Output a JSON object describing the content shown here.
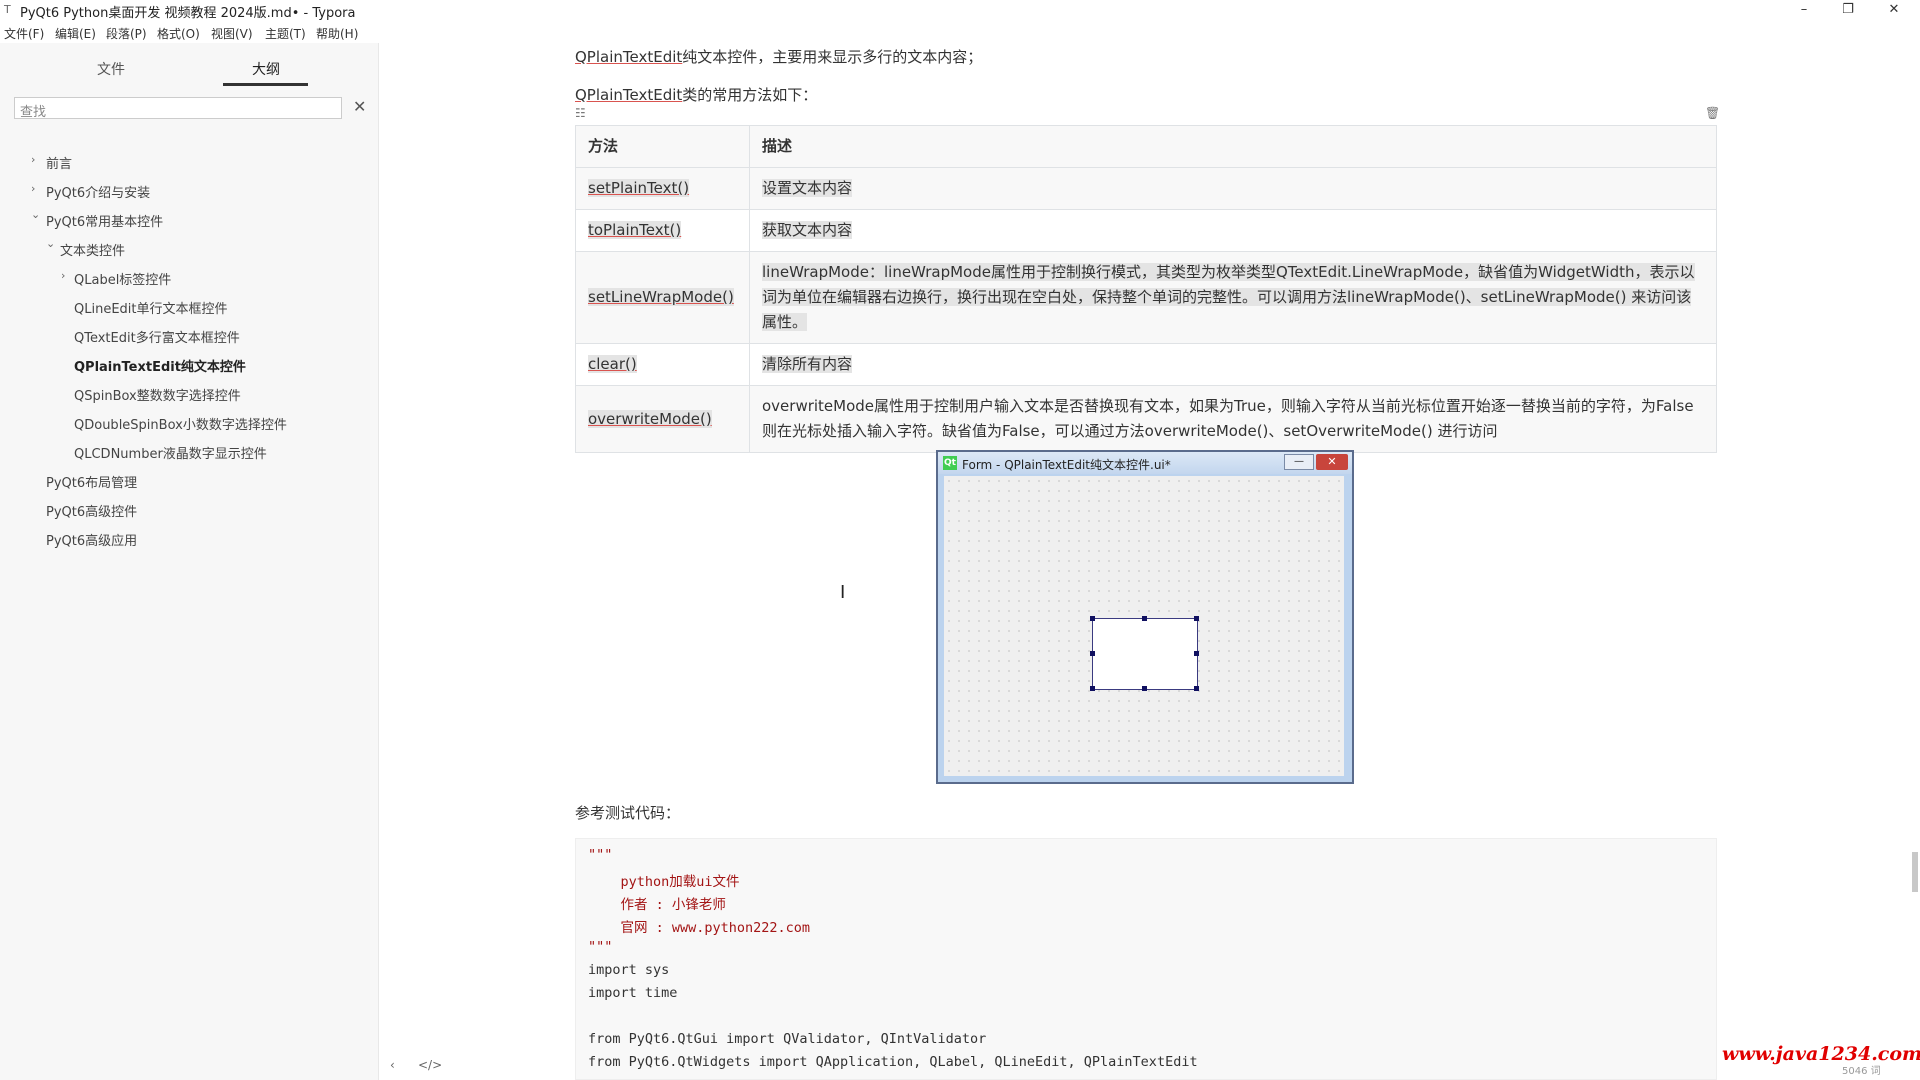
{
  "window": {
    "title": "PyQt6 Python桌面开发 视频教程 2024版.md• - Typora",
    "minimize": "–",
    "restore": "❐",
    "close": "✕"
  },
  "menu": [
    "文件(F)",
    "编辑(E)",
    "段落(P)",
    "格式(O)",
    "视图(V)",
    "主题(T)",
    "帮助(H)"
  ],
  "sidebar": {
    "tab_files": "文件",
    "tab_outline": "大纲",
    "search_placeholder": "查找",
    "search_close": "✕",
    "items": [
      {
        "label": "前言",
        "chev": "›"
      },
      {
        "label": "PyQt6介绍与安装",
        "chev": "›"
      },
      {
        "label": "PyQt6常用基本控件",
        "chev": "⌄"
      },
      {
        "label": "文本类控件",
        "chev": "⌄"
      },
      {
        "label": "QLabel标签控件",
        "chev": "›"
      },
      {
        "label": "QLineEdit单行文本框控件",
        "chev": ""
      },
      {
        "label": "QTextEdit多行富文本框控件",
        "chev": ""
      },
      {
        "label": "QPlainTextEdit纯文本控件",
        "chev": ""
      },
      {
        "label": "QSpinBox整数数字选择控件",
        "chev": ""
      },
      {
        "label": "QDoubleSpinBox小数数字选择控件",
        "chev": ""
      },
      {
        "label": "QLCDNumber液晶数字显示控件",
        "chev": ""
      },
      {
        "label": "PyQt6布局管理",
        "chev": ""
      },
      {
        "label": "PyQt6高级控件",
        "chev": ""
      },
      {
        "label": "PyQt6高级应用",
        "chev": ""
      }
    ],
    "footer_prev": "‹",
    "footer_source": "</>"
  },
  "content": {
    "intro_name": "QPlainTextEdit",
    "intro_rest": "纯文本控件，主要用来显示多行的文本内容；",
    "methods_name": "QPlainTextEdit",
    "methods_rest": "类的常用方法如下：",
    "table_grid_icon": "☷",
    "table_delete_icon": "🗑",
    "table_headers": [
      "方法",
      "描述"
    ],
    "table_rows": [
      {
        "method": "setPlainText()",
        "desc": "设置文本内容"
      },
      {
        "method": "toPlainText()",
        "desc": "获取文本内容"
      },
      {
        "method": "setLineWrapMode()",
        "desc": "lineWrapMode：lineWrapMode属性用于控制换行模式，其类型为枚举类型QTextEdit.LineWrapMode，缺省值为WidgetWidth，表示以词为单位在编辑器右边换行，换行出现在空白处，保持整个单词的完整性。可以调用方法lineWrapMode()、setLineWrapMode()  来访问该属性。"
      },
      {
        "method": "clear()",
        "desc": "清除所有内容"
      },
      {
        "method": "overwriteMode()",
        "desc": "overwriteMode属性用于控制用户输入文本是否替换现有文本，如果为True，则输入字符从当前光标位置开始逐一替换当前的字符，为False则在光标处插入输入字符。缺省值为False，可以通过方法overwriteMode()、setOverwriteMode()  进行访问"
      }
    ],
    "qt_window_title": "Form - QPlainTextEdit纯文本控件.ui*",
    "qt_logo": "Qt",
    "qt_min": "—",
    "qt_close": "✕",
    "cursor_glyph": "I",
    "ref_label": "参考测试代码：",
    "code_lines": [
      "\"\"\"",
      "    python加载ui文件",
      "    作者 : 小锋老师",
      "    官网 : www.python222.com",
      "\"\"\"",
      "import sys",
      "import time",
      "",
      "from PyQt6.QtGui import QValidator, QIntValidator",
      "from PyQt6.QtWidgets import QApplication, QLabel, QLineEdit, QPlainTextEdit"
    ]
  },
  "watermark": "www.java1234.com",
  "status_words": "5046 词"
}
